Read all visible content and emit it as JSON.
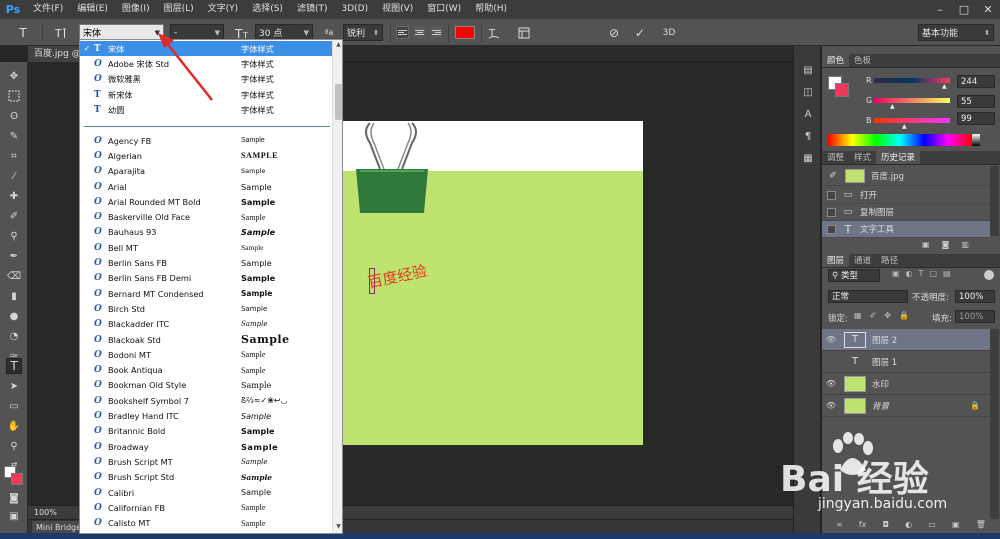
{
  "app": {
    "logo": "Ps"
  },
  "menubar": {
    "items": [
      "文件(F)",
      "编辑(E)",
      "图像(I)",
      "图层(L)",
      "文字(Y)",
      "选择(S)",
      "滤镜(T)",
      "3D(D)",
      "视图(V)",
      "窗口(W)",
      "帮助(H)"
    ],
    "window_controls": [
      "–",
      "□",
      "✕"
    ]
  },
  "options_bar": {
    "tool_icon": "T",
    "orientation_icon": "text-orientation-icon",
    "font_family": "宋体",
    "font_style": "-",
    "size_icon": "font-size-icon",
    "font_size": "30 点",
    "aa_label": "ªa",
    "antialias": "锐利",
    "text_color": "#ff0000",
    "cancel_icon": "⊘",
    "commit_icon": "✓",
    "threed_label": "3D",
    "workspace": "基本功能"
  },
  "document": {
    "tab_title": "百度.jpg @",
    "canvas_text": "百度经验",
    "zoom": "100%",
    "minibridge_label": "Mini Bridge"
  },
  "font_dropdown": {
    "recent": [
      {
        "name": "宋体",
        "sample": "字体样式",
        "type": "tt",
        "selected": true
      },
      {
        "name": "Adobe 宋体 Std",
        "sample": "字体样式",
        "type": "ot"
      },
      {
        "name": "微软雅黑",
        "sample": "字体样式",
        "type": "ot"
      },
      {
        "name": "新宋体",
        "sample": "字体样式",
        "type": "tt"
      },
      {
        "name": "幼圆",
        "sample": "字体样式",
        "type": "tt"
      }
    ],
    "fonts": [
      {
        "name": "Agency FB",
        "sample": "Sample"
      },
      {
        "name": "Algerian",
        "sample": "SAMPLE"
      },
      {
        "name": "Aparajita",
        "sample": "Sample"
      },
      {
        "name": "Arial",
        "sample": "Sample"
      },
      {
        "name": "Arial Rounded MT Bold",
        "sample": "Sample"
      },
      {
        "name": "Baskerville Old Face",
        "sample": "Sample"
      },
      {
        "name": "Bauhaus 93",
        "sample": "Sample"
      },
      {
        "name": "Bell MT",
        "sample": "Sample"
      },
      {
        "name": "Berlin Sans FB",
        "sample": "Sample"
      },
      {
        "name": "Berlin Sans FB Demi",
        "sample": "Sample"
      },
      {
        "name": "Bernard MT Condensed",
        "sample": "Sample"
      },
      {
        "name": "Birch Std",
        "sample": "Sample"
      },
      {
        "name": "Blackadder ITC",
        "sample": "Sample"
      },
      {
        "name": "Blackoak Std",
        "sample": "Sample"
      },
      {
        "name": "Bodoni MT",
        "sample": "Sample"
      },
      {
        "name": "Book Antiqua",
        "sample": "Sample"
      },
      {
        "name": "Bookman Old Style",
        "sample": "Sample"
      },
      {
        "name": "Bookshelf Symbol 7",
        "sample": "ß⅔≈✓❀↩◡"
      },
      {
        "name": "Bradley Hand ITC",
        "sample": "Sample"
      },
      {
        "name": "Britannic Bold",
        "sample": "Sample"
      },
      {
        "name": "Broadway",
        "sample": "Sample"
      },
      {
        "name": "Brush Script MT",
        "sample": "Sample"
      },
      {
        "name": "Brush Script Std",
        "sample": "Sample"
      },
      {
        "name": "Calibri",
        "sample": "Sample"
      },
      {
        "name": "Californian FB",
        "sample": "Sample"
      },
      {
        "name": "Calisto MT",
        "sample": "Sample"
      }
    ]
  },
  "color_panel": {
    "tabs": [
      "颜色",
      "色板"
    ],
    "r_label": "R",
    "g_label": "G",
    "b_label": "B",
    "r": "244",
    "g": "55",
    "b": "99",
    "fg_color": "#ffffff",
    "bg_color": "#f4375f"
  },
  "history_panel": {
    "tabs": [
      "调整",
      "样式",
      "历史记录"
    ],
    "snapshot": "百度.jpg",
    "steps": [
      "打开",
      "复制图层",
      "文字工具"
    ]
  },
  "layers_panel": {
    "tabs": [
      "图层",
      "通道",
      "路径"
    ],
    "filter_kind": "类型",
    "blend_mode": "正常",
    "opacity_label": "不透明度:",
    "opacity": "100%",
    "lock_label": "锁定:",
    "fill_label": "填充:",
    "fill": "100%",
    "layers": [
      {
        "name": "图层 2",
        "thumb": "T",
        "kind": "text",
        "selected": true
      },
      {
        "name": "图层 1",
        "thumb": "T",
        "kind": "text",
        "selected": false
      },
      {
        "name": "水印",
        "thumb": "",
        "kind": "image",
        "selected": false
      },
      {
        "name": "背景",
        "thumb": "",
        "kind": "image",
        "selected": false,
        "locked": true
      }
    ],
    "footer_icons": [
      "∞",
      "fx",
      "◘",
      "◐",
      "▭",
      "▣",
      "🗑"
    ]
  },
  "watermark": {
    "text": "Bai 经验",
    "url": "jingyan.baidu.com"
  }
}
